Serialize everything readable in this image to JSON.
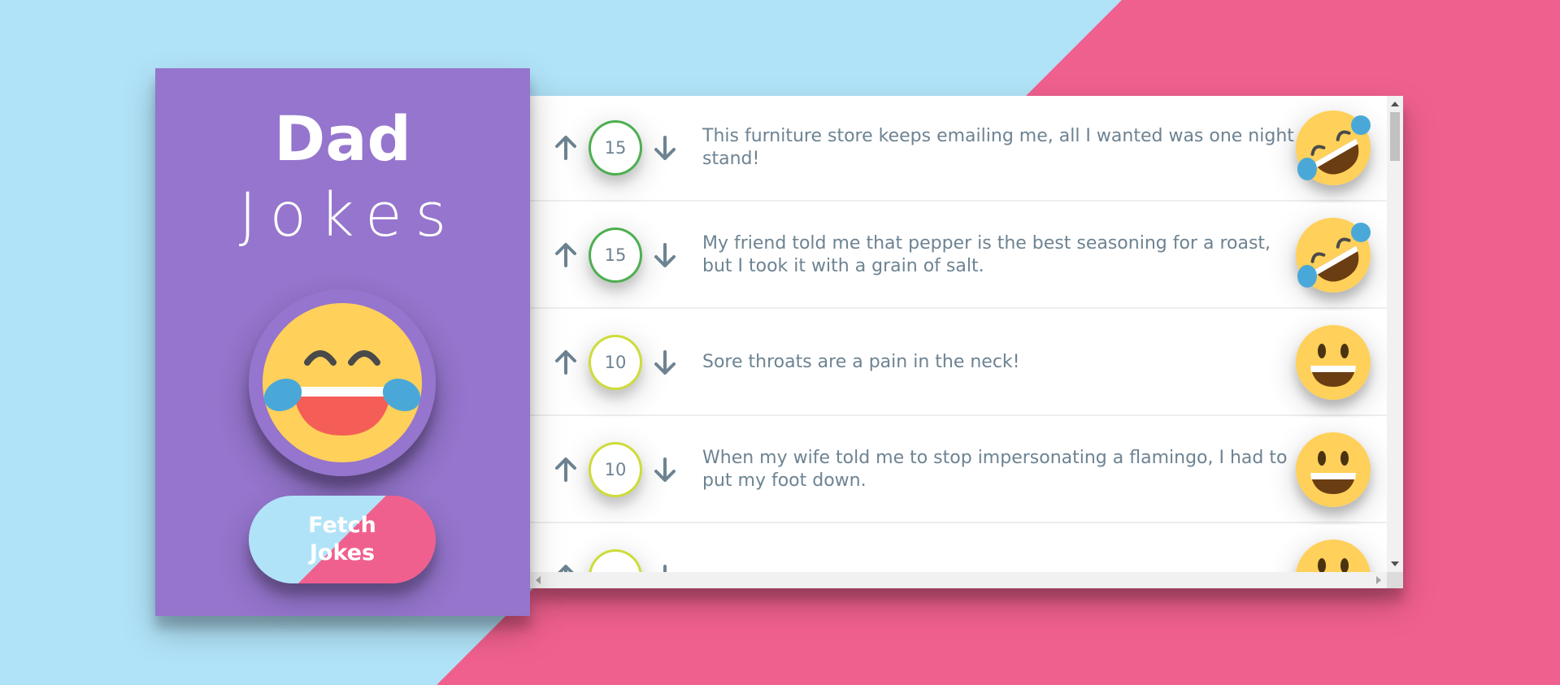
{
  "colors": {
    "background_blue": "#b1e3f8",
    "background_pink": "#f0608e",
    "sidebar_purple": "#9575cd",
    "text_gray": "#6d8392",
    "score_green": "#4caf50",
    "score_lime": "#cddc39"
  },
  "sidebar": {
    "title_bold": "Dad",
    "title_light": "Jokes",
    "emoji_icon": "laughing-tears-emoji-icon",
    "fetch_button_label": "Fetch Jokes"
  },
  "jokes": [
    {
      "score": "15",
      "text": "This furniture store keeps emailing me, all I wanted was one night stand!",
      "emoji": "rolling-on-floor-laughing-icon",
      "score_color": "#4caf50"
    },
    {
      "score": "15",
      "text": "My friend told me that pepper is the best seasoning for a roast, but I took it with a grain of salt.",
      "emoji": "rolling-on-floor-laughing-icon",
      "score_color": "#4caf50"
    },
    {
      "score": "10",
      "text": "Sore throats are a pain in the neck!",
      "emoji": "grinning-face-icon",
      "score_color": "#cddc39"
    },
    {
      "score": "10",
      "text": "When my wife told me to stop impersonating a flamingo, I had to put my foot down.",
      "emoji": "grinning-face-icon",
      "score_color": "#cddc39"
    },
    {
      "score": "",
      "text": "",
      "emoji": "grinning-face-icon",
      "score_color": "#cddc39"
    }
  ],
  "icons": {
    "upvote": "arrow-up-icon",
    "downvote": "arrow-down-icon"
  }
}
